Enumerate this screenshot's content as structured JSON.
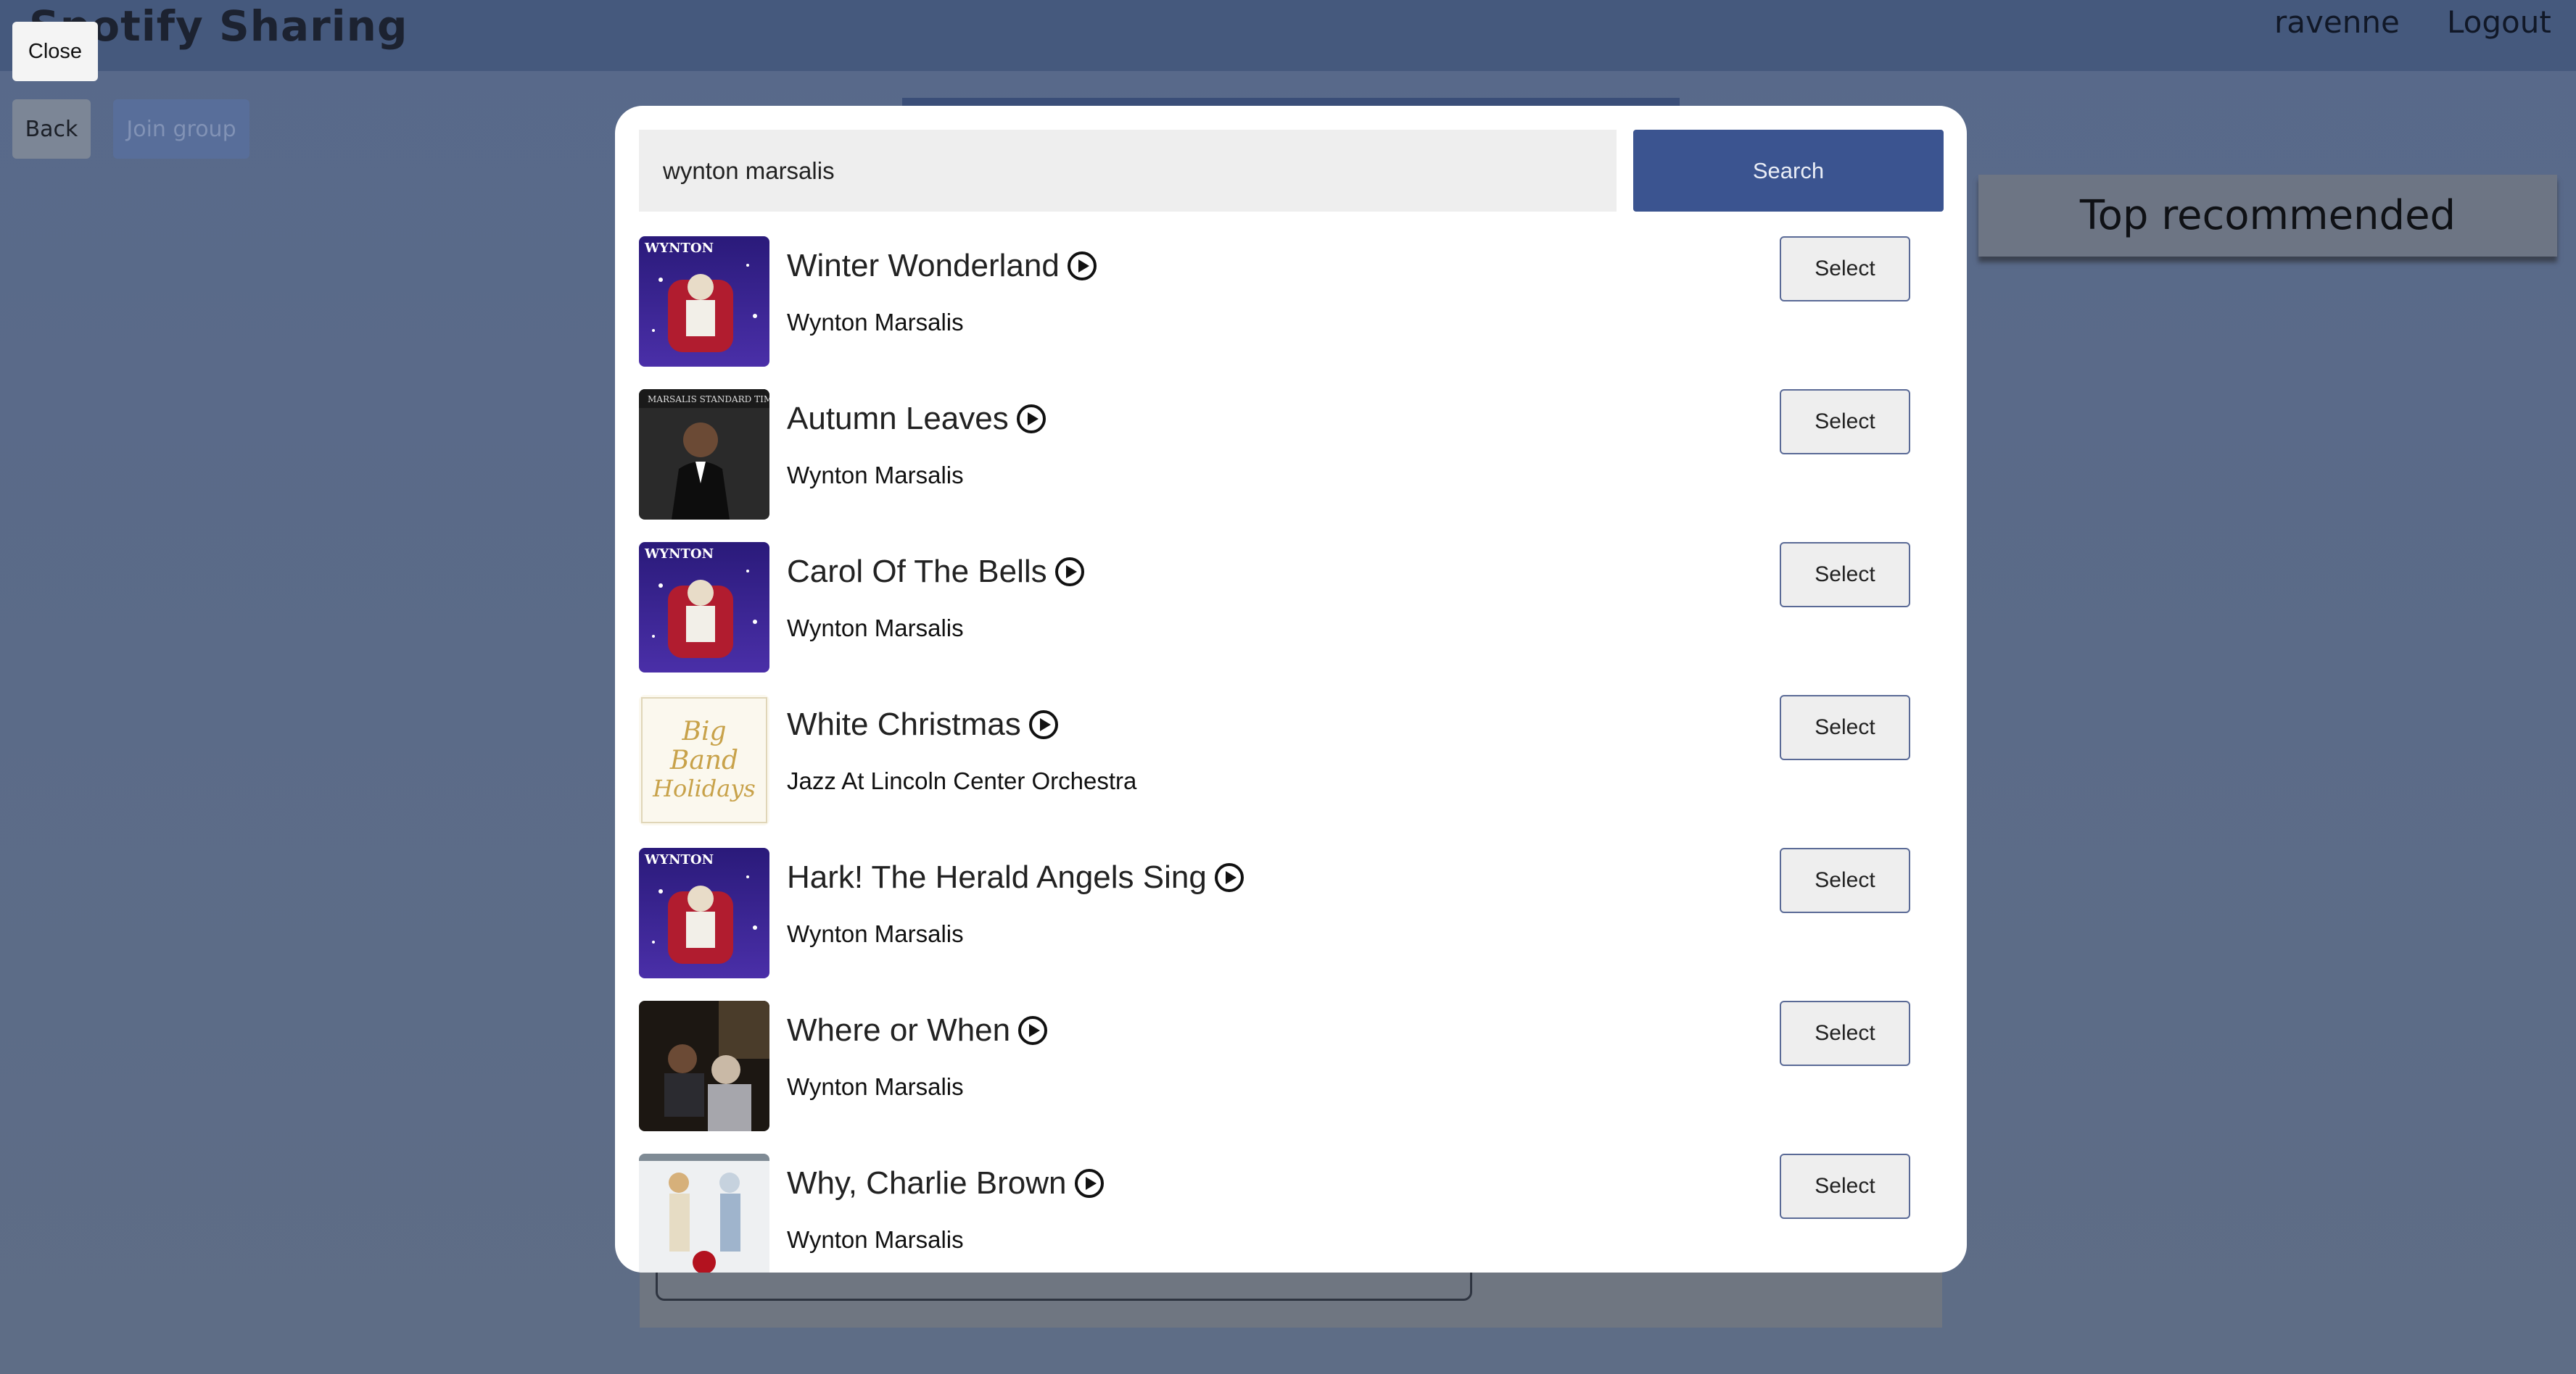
{
  "app": {
    "title": "Spotify Sharing",
    "user": "ravenne",
    "logout_label": "Logout"
  },
  "background": {
    "back_label": "Back",
    "join_label": "Join group",
    "top_recommended": "Top recommended"
  },
  "modal": {
    "close_label": "Close",
    "search": {
      "value": "wynton marsalis",
      "button_label": "Search"
    },
    "results": [
      {
        "title": "Winter Wonderland",
        "artist": "Wynton Marsalis",
        "select_label": "Select",
        "cover": "christmas"
      },
      {
        "title": "Autumn Leaves",
        "artist": "Wynton Marsalis",
        "select_label": "Select",
        "cover": "portrait"
      },
      {
        "title": "Carol Of The Bells",
        "artist": "Wynton Marsalis",
        "select_label": "Select",
        "cover": "christmas"
      },
      {
        "title": "White Christmas",
        "artist": "Jazz At Lincoln Center Orchestra",
        "select_label": "Select",
        "cover": "bigband"
      },
      {
        "title": "Hark! The Herald Angels Sing",
        "artist": "Wynton Marsalis",
        "select_label": "Select",
        "cover": "christmas"
      },
      {
        "title": "Where or When",
        "artist": "Wynton Marsalis",
        "select_label": "Select",
        "cover": "duo"
      },
      {
        "title": "Why, Charlie Brown",
        "artist": "Wynton Marsalis",
        "select_label": "Select",
        "cover": "charlie"
      }
    ]
  },
  "colors": {
    "accent": "#3b5490",
    "overlay": "#5a6a86",
    "topbar": "#45597d"
  }
}
